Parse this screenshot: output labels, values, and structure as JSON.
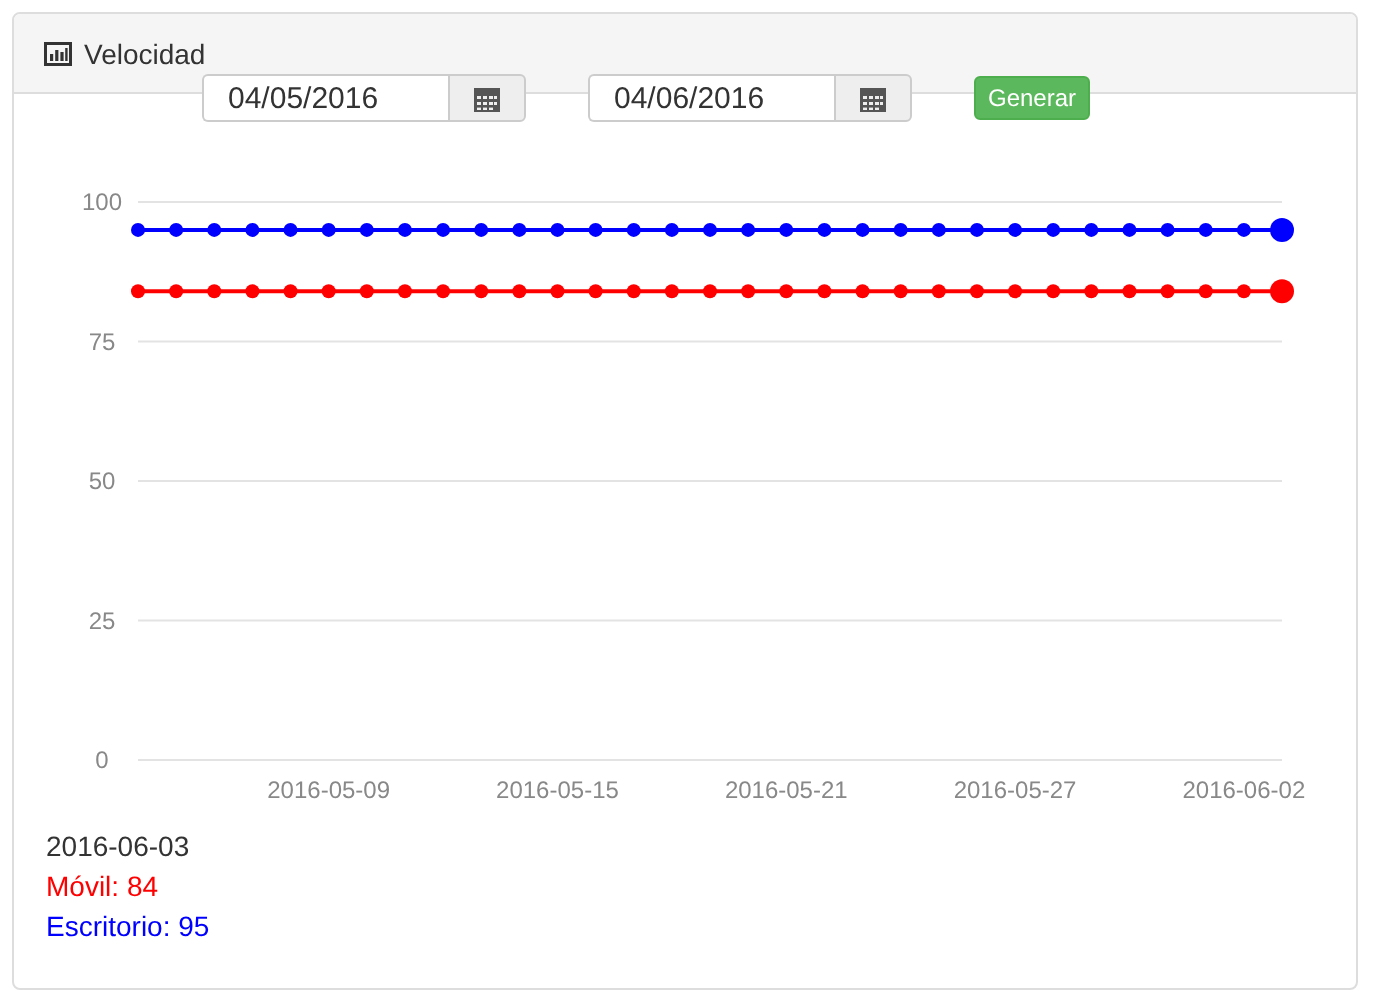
{
  "panel": {
    "title": "Velocidad"
  },
  "controls": {
    "start_date": "04/05/2016",
    "end_date": "04/06/2016",
    "button": "Generar"
  },
  "chart_data": {
    "type": "line",
    "categories": [
      null,
      null,
      null,
      null,
      null,
      "2016-05-09",
      null,
      null,
      null,
      null,
      null,
      "2016-05-15",
      null,
      null,
      null,
      null,
      null,
      "2016-05-21",
      null,
      null,
      null,
      null,
      null,
      "2016-05-27",
      null,
      null,
      null,
      null,
      null,
      "2016-06-02",
      null
    ],
    "series": [
      {
        "color": "#0000ff",
        "marker": "circle",
        "values": [
          95,
          95,
          95,
          95,
          95,
          95,
          95,
          95,
          95,
          95,
          95,
          95,
          95,
          95,
          95,
          95,
          95,
          95,
          95,
          95,
          95,
          95,
          95,
          95,
          95,
          95,
          95,
          95,
          95,
          95,
          95
        ]
      },
      {
        "color": "#ff0000",
        "marker": "circle",
        "values": [
          84,
          84,
          84,
          84,
          84,
          84,
          84,
          84,
          84,
          84,
          84,
          84,
          84,
          84,
          84,
          84,
          84,
          84,
          84,
          84,
          84,
          84,
          84,
          84,
          84,
          84,
          84,
          84,
          84,
          84,
          84
        ]
      }
    ],
    "ylim": [
      0,
      100
    ],
    "yticks": [
      0,
      25,
      50,
      75,
      100
    ],
    "grid": true
  },
  "legend": {
    "date": "2016-06-03",
    "items": [
      {
        "label": "Móvil: 84",
        "color": "#ff0000"
      },
      {
        "label": "Escritorio: 95",
        "color": "#0000ff"
      }
    ]
  }
}
